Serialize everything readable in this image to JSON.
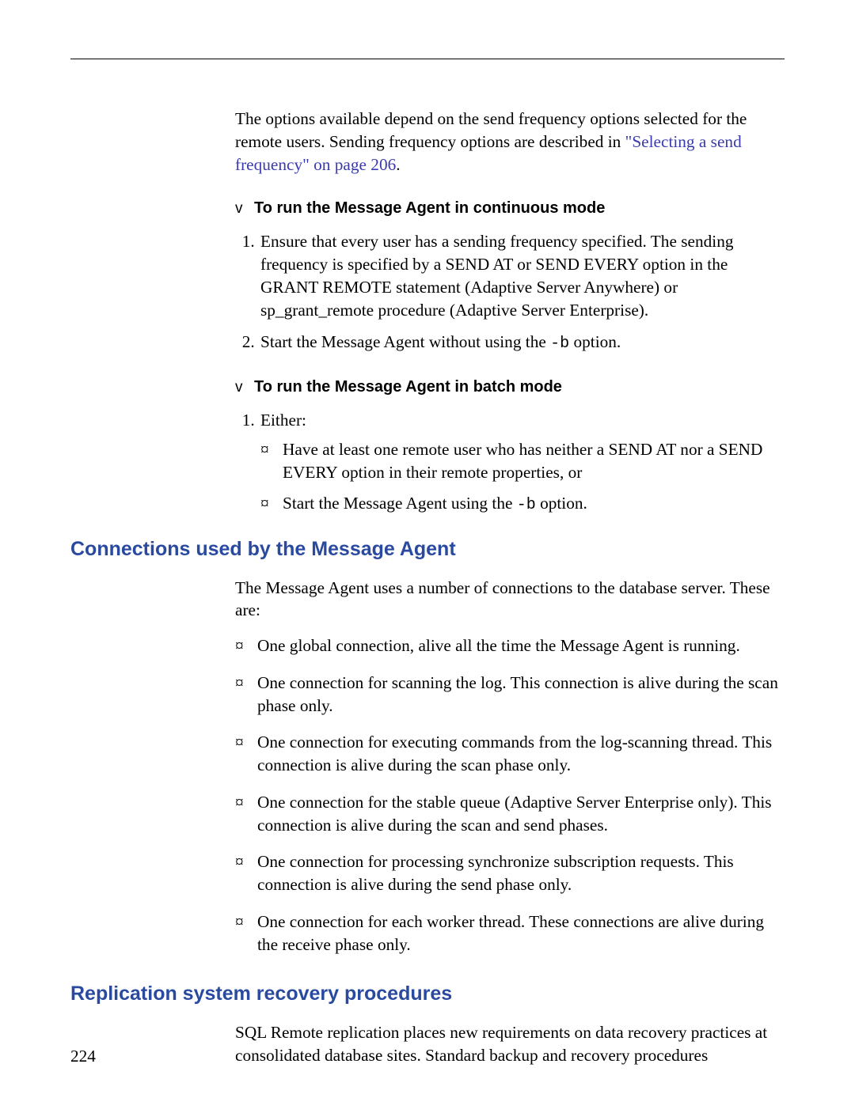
{
  "intro": {
    "text_before_link": "The options available depend on the send frequency options selected for the remote users. Sending frequency options are described in ",
    "link_text": "\"Selecting a send frequency\" on page 206",
    "text_after_link": "."
  },
  "proc1": {
    "marker": "v",
    "title": "To run the Message Agent in continuous mode",
    "step1_prefix": "1.",
    "step1_text": "Ensure that every user has a sending frequency specified. The sending frequency is specified by a SEND AT or SEND EVERY option in the GRANT REMOTE statement (Adaptive Server Anywhere) or sp_grant_remote   procedure (Adaptive Server Enterprise).",
    "step2_prefix": "2.",
    "step2_before_mono": "Start the Message Agent without using the ",
    "step2_mono": "-b",
    "step2_after_mono": " option."
  },
  "proc2": {
    "marker": "v",
    "title": "To run the Message Agent in batch mode",
    "step1_prefix": "1.",
    "step1_text": "Either:",
    "bullet_char": "¤",
    "sub1": "Have at least one remote user who has neither a SEND AT nor a SEND EVERY option in their remote properties, or",
    "sub2_before_mono": "Start the Message Agent using the ",
    "sub2_mono": "-b",
    "sub2_after_mono": " option."
  },
  "connections": {
    "heading": "Connections used by the Message Agent",
    "intro": "The Message Agent uses a number of connections to the database server. These are:",
    "bullet_char": "¤",
    "items": [
      "One global connection, alive all the time the Message Agent is running.",
      "One connection for scanning the log. This connection is alive during the scan phase only.",
      "One connection for executing commands from the log-scanning thread. This connection is alive during the scan phase only.",
      "One connection for the stable queue (Adaptive Server Enterprise only). This connection is alive during the scan and send phases.",
      "One connection for processing synchronize subscription requests. This connection is alive during the send phase only.",
      "One connection for each worker thread. These connections are alive during the receive phase only."
    ]
  },
  "recovery": {
    "heading": "Replication system recovery procedures",
    "intro": "SQL Remote replication places new requirements on data recovery practices at consolidated database sites. Standard backup and recovery procedures"
  },
  "page_number": "224"
}
